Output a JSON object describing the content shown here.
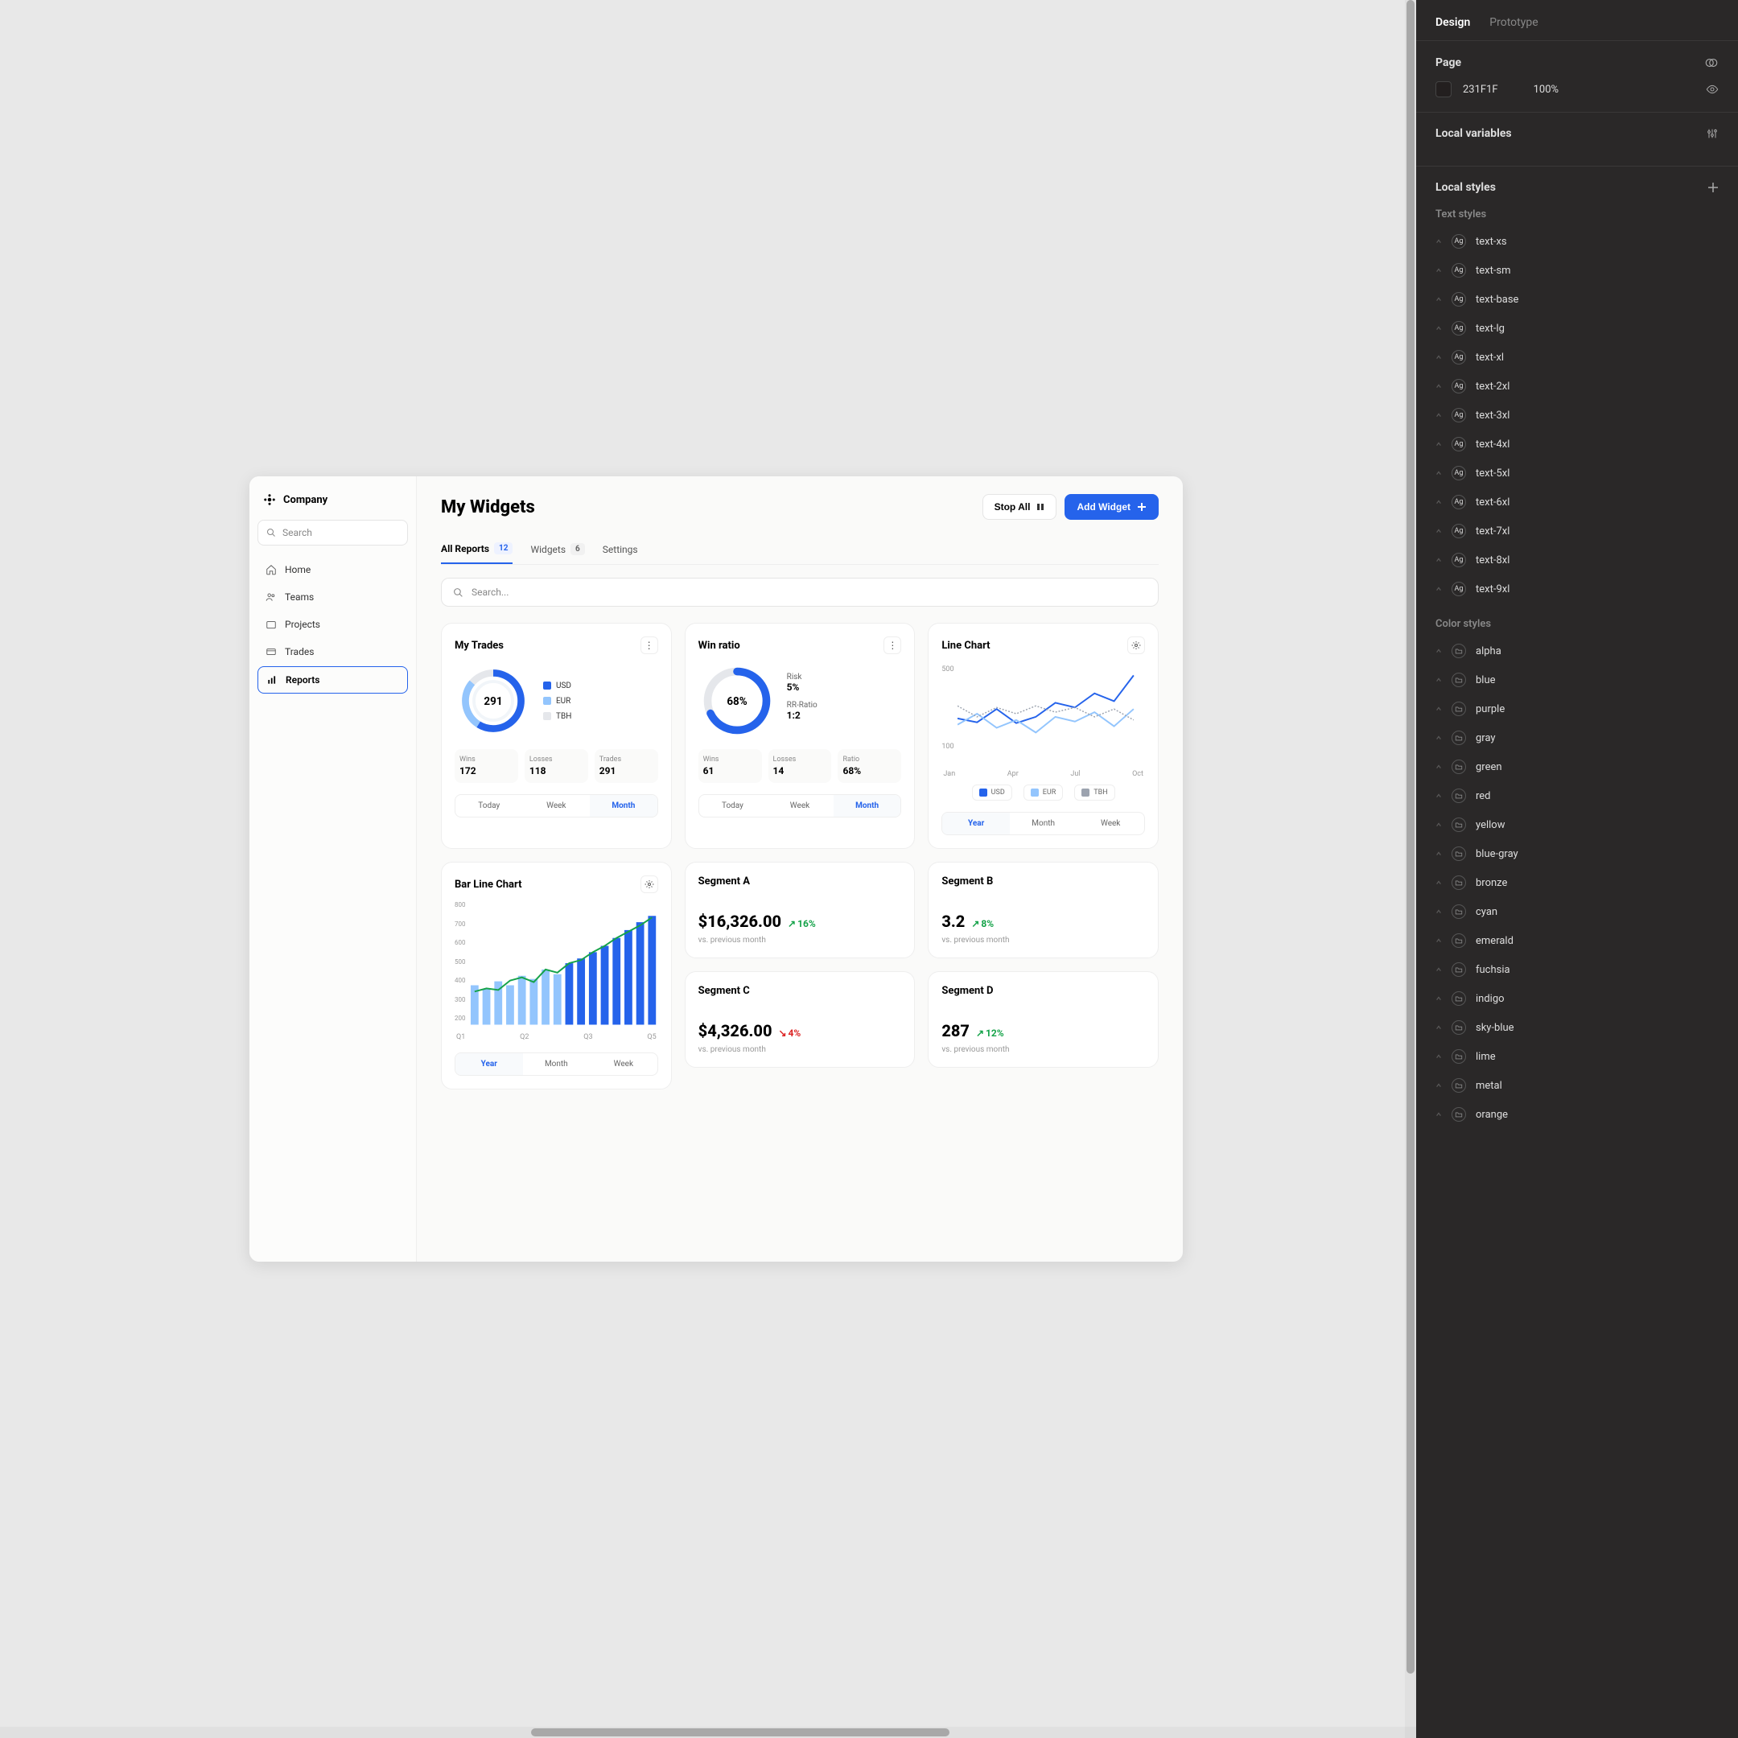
{
  "inspector": {
    "tabs": [
      "Design",
      "Prototype"
    ],
    "active_tab": "Design",
    "page_label": "Page",
    "page_color": "231F1F",
    "page_opacity": "100%",
    "local_variables_label": "Local variables",
    "local_styles_label": "Local styles",
    "text_styles_label": "Text styles",
    "color_styles_label": "Color styles",
    "text_styles": [
      "text-xs",
      "text-sm",
      "text-base",
      "text-lg",
      "text-xl",
      "text-2xl",
      "text-3xl",
      "text-4xl",
      "text-5xl",
      "text-6xl",
      "text-7xl",
      "text-8xl",
      "text-9xl"
    ],
    "color_styles": [
      "alpha",
      "blue",
      "purple",
      "gray",
      "green",
      "red",
      "yellow",
      "blue-gray",
      "bronze",
      "cyan",
      "emerald",
      "fuchsia",
      "indigo",
      "sky-blue",
      "lime",
      "metal",
      "orange"
    ]
  },
  "sidebar": {
    "company": "Company",
    "search_placeholder": "Search",
    "items": [
      {
        "label": "Home"
      },
      {
        "label": "Teams"
      },
      {
        "label": "Projects"
      },
      {
        "label": "Trades"
      },
      {
        "label": "Reports"
      }
    ],
    "active_index": 4
  },
  "main": {
    "title": "My Widgets",
    "stop_all": "Stop All",
    "add_widget": "Add Widget",
    "tabs": [
      {
        "label": "All Reports",
        "badge": "12"
      },
      {
        "label": "Widgets",
        "badge": "6"
      },
      {
        "label": "Settings"
      }
    ],
    "search_placeholder": "Search..."
  },
  "widgets": {
    "my_trades": {
      "title": "My Trades",
      "center": "291",
      "legend": [
        {
          "label": "USD",
          "color": "#2563eb"
        },
        {
          "label": "EUR",
          "color": "#93c5fd"
        },
        {
          "label": "TBH",
          "color": "#e5e7eb"
        }
      ],
      "stats": [
        {
          "label": "Wins",
          "value": "172"
        },
        {
          "label": "Losses",
          "value": "118"
        },
        {
          "label": "Trades",
          "value": "291"
        }
      ],
      "timeframes": [
        "Today",
        "Week",
        "Month"
      ],
      "active_tf": 2
    },
    "win_ratio": {
      "title": "Win ratio",
      "center": "68%",
      "risk_label": "Risk",
      "risk_value": "5%",
      "rr_label": "RR-Ratio",
      "rr_value": "1:2",
      "stats": [
        {
          "label": "Wins",
          "value": "61"
        },
        {
          "label": "Losses",
          "value": "14"
        },
        {
          "label": "Ratio",
          "value": "68%"
        }
      ],
      "timeframes": [
        "Today",
        "Week",
        "Month"
      ],
      "active_tf": 2
    },
    "line_chart": {
      "title": "Line Chart",
      "y_top": "500",
      "y_bot": "100",
      "x_labels": [
        "Jan",
        "Apr",
        "Jul",
        "Oct"
      ],
      "legend": [
        "USD",
        "EUR",
        "TBH"
      ],
      "timeframes": [
        "Year",
        "Month",
        "Week"
      ],
      "active_tf": 0
    },
    "bar_line": {
      "title": "Bar Line Chart",
      "y_labels": [
        "800",
        "700",
        "600",
        "500",
        "400",
        "300",
        "200"
      ],
      "x_labels": [
        "Q1",
        "Q2",
        "Q3",
        "Q5"
      ],
      "timeframes": [
        "Year",
        "Month",
        "Week"
      ],
      "active_tf": 0
    },
    "segments": [
      {
        "title": "Segment A",
        "value": "$16,326.00",
        "delta": "16%",
        "dir": "up",
        "sub": "vs. previous month"
      },
      {
        "title": "Segment B",
        "value": "3.2",
        "delta": "8%",
        "dir": "up",
        "sub": "vs. previous month"
      },
      {
        "title": "Segment C",
        "value": "$4,326.00",
        "delta": "4%",
        "dir": "down",
        "sub": "vs. previous month"
      },
      {
        "title": "Segment D",
        "value": "287",
        "delta": "12%",
        "dir": "up",
        "sub": "vs. previous month"
      }
    ]
  },
  "chart_data": [
    {
      "type": "pie",
      "title": "My Trades",
      "series": [
        {
          "name": "USD",
          "value": 172,
          "color": "#2563eb"
        },
        {
          "name": "EUR",
          "value": 80,
          "color": "#93c5fd"
        },
        {
          "name": "TBH",
          "value": 39,
          "color": "#e5e7eb"
        }
      ],
      "center_label": "291"
    },
    {
      "type": "pie",
      "title": "Win ratio",
      "series": [
        {
          "name": "Wins",
          "value": 68
        },
        {
          "name": "Losses",
          "value": 32
        }
      ],
      "center_label": "68%"
    },
    {
      "type": "line",
      "title": "Line Chart",
      "x": [
        "Jan",
        "Apr",
        "Jul",
        "Oct"
      ],
      "ylim": [
        100,
        500
      ],
      "series": [
        {
          "name": "USD",
          "values": [
            260,
            240,
            300,
            230,
            260,
            320,
            300,
            370,
            330,
            480
          ],
          "color": "#2563eb"
        },
        {
          "name": "EUR",
          "values": [
            230,
            280,
            210,
            250,
            200,
            270,
            250,
            290,
            230,
            310
          ],
          "color": "#93c5fd"
        },
        {
          "name": "TBH",
          "values": [
            320,
            260,
            310,
            280,
            320,
            290,
            310,
            260,
            300,
            240
          ],
          "color": "#9ca3af"
        }
      ]
    },
    {
      "type": "bar",
      "title": "Bar Line Chart",
      "categories": [
        "Q1",
        "Q2",
        "Q3",
        "Q5"
      ],
      "ylim": [
        200,
        800
      ],
      "series": [
        {
          "name": "bars",
          "values": [
            320,
            280,
            350,
            300,
            380,
            340,
            420,
            360,
            450,
            480,
            520,
            560,
            600,
            650,
            700,
            730
          ],
          "color": "#2563eb"
        },
        {
          "name": "line",
          "values": [
            300,
            320,
            310,
            360,
            380,
            350,
            420,
            400,
            460,
            480,
            520,
            560,
            600,
            640,
            680,
            720
          ],
          "color": "#16a34a"
        }
      ]
    }
  ]
}
